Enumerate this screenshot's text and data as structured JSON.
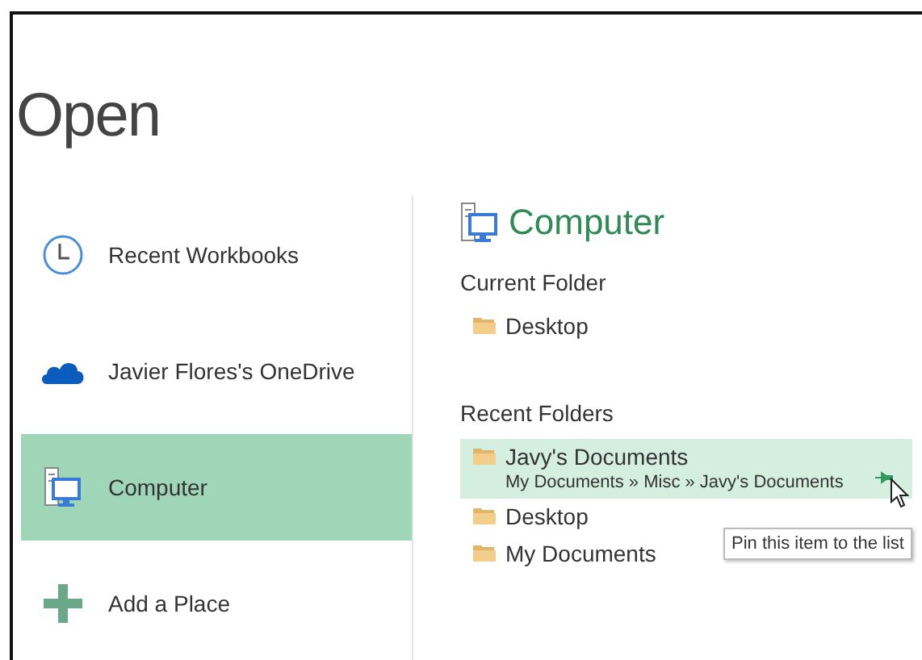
{
  "title": "Open",
  "places": [
    {
      "kind": "recent",
      "label": "Recent Workbooks",
      "selected": false
    },
    {
      "kind": "onedrive",
      "label": "Javier Flores's OneDrive",
      "selected": false
    },
    {
      "kind": "computer",
      "label": "Computer",
      "selected": true
    },
    {
      "kind": "add",
      "label": "Add a Place",
      "selected": false
    }
  ],
  "panel": {
    "heading": "Computer",
    "current_folder": {
      "label": "Current Folder",
      "items": [
        {
          "name": "Desktop"
        }
      ]
    },
    "recent_folders": {
      "label": "Recent Folders",
      "items": [
        {
          "name": "Javy's Documents",
          "path": "My Documents » Misc » Javy's Documents",
          "selected": true,
          "tooltip": "Pin this item to the list"
        },
        {
          "name": "Desktop",
          "selected": false
        },
        {
          "name": "My Documents",
          "selected": false
        }
      ]
    }
  }
}
